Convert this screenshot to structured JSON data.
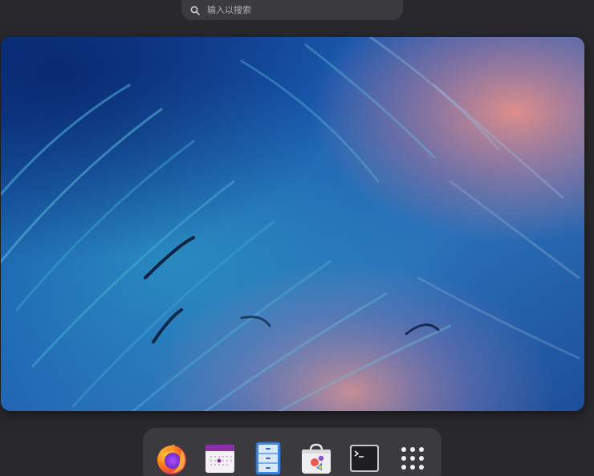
{
  "search": {
    "placeholder": "输入以搜索",
    "icon": "search-icon"
  },
  "workspace": {
    "label": "workspace-thumbnail"
  },
  "dock": {
    "items": [
      {
        "icon": "firefox-icon"
      },
      {
        "icon": "calendar-icon"
      },
      {
        "icon": "files-icon"
      },
      {
        "icon": "software-store-icon"
      },
      {
        "icon": "terminal-icon"
      },
      {
        "icon": "show-apps-grid-icon"
      }
    ]
  },
  "colors": {
    "background": "#29292d",
    "panel": "#3a3a3f",
    "wallpaper_primary": "#1e5aa8",
    "wallpaper_accent": "#d9877f"
  }
}
